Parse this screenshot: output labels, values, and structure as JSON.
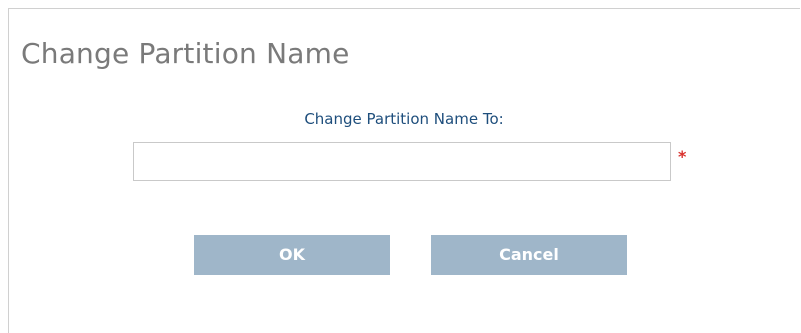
{
  "dialog": {
    "title": "Change Partition Name",
    "field_label": "Change Partition Name To:",
    "input_value": "",
    "input_placeholder": "",
    "required_marker": "*",
    "ok_label": "OK",
    "cancel_label": "Cancel"
  },
  "colors": {
    "title": "#7a7a7a",
    "label": "#1e4e7c",
    "button_bg": "#9fb6c9",
    "button_text": "#ffffff",
    "required": "#d9302c"
  }
}
